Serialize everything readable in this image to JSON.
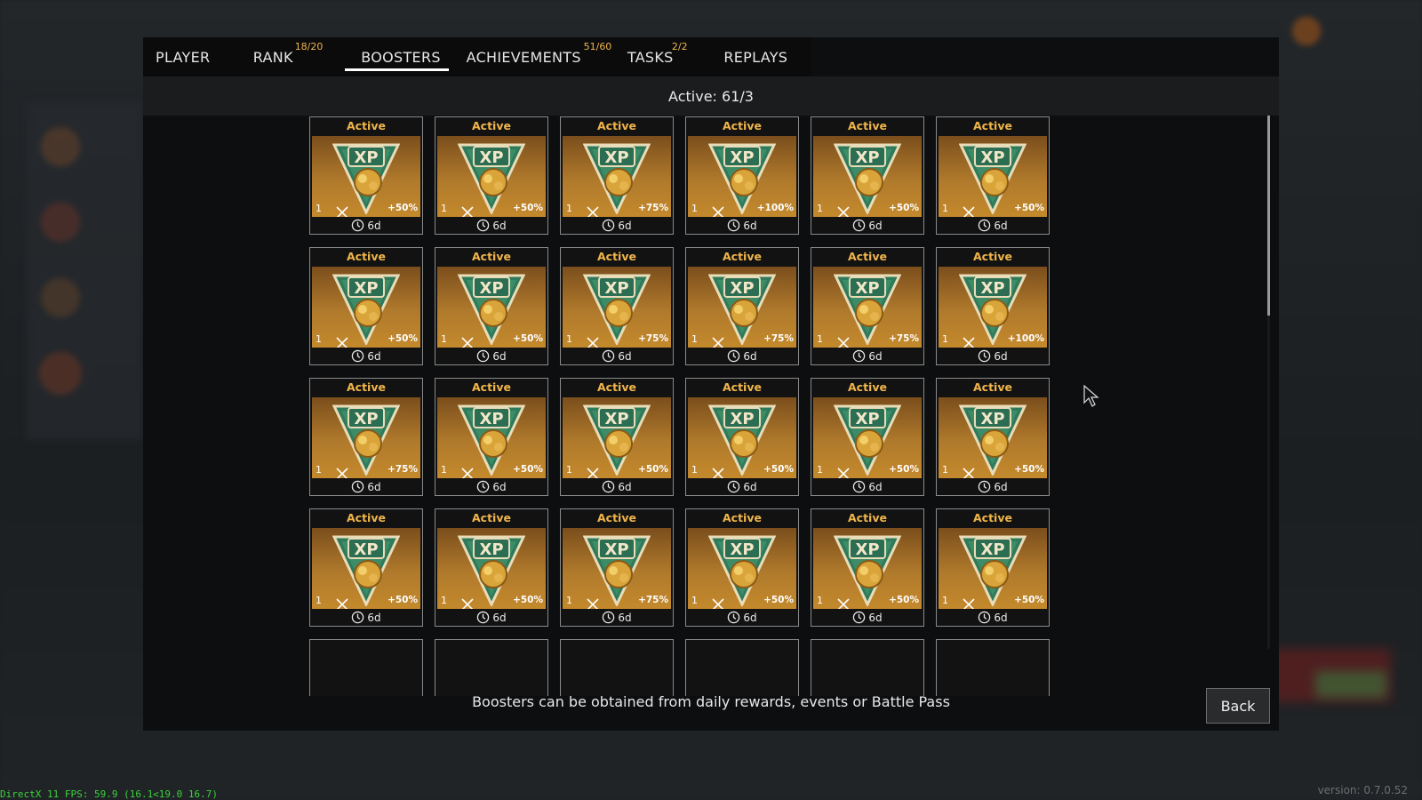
{
  "tabs": [
    {
      "label": "PLAYER",
      "badge": ""
    },
    {
      "label": "RANK",
      "badge": "18/20"
    },
    {
      "label": "BOOSTERS",
      "badge": ""
    },
    {
      "label": "ACHIEVEMENTS",
      "badge": "51/60"
    },
    {
      "label": "TASKS",
      "badge": "2/2"
    },
    {
      "label": "REPLAYS",
      "badge": ""
    }
  ],
  "active_tab": "BOOSTERS",
  "active_summary": "Active: 61/3",
  "boosters": [
    {
      "state": "Active",
      "count": "1",
      "bonus": "+50%",
      "time": "6d"
    },
    {
      "state": "Active",
      "count": "1",
      "bonus": "+50%",
      "time": "6d"
    },
    {
      "state": "Active",
      "count": "1",
      "bonus": "+75%",
      "time": "6d"
    },
    {
      "state": "Active",
      "count": "1",
      "bonus": "+100%",
      "time": "6d"
    },
    {
      "state": "Active",
      "count": "1",
      "bonus": "+50%",
      "time": "6d"
    },
    {
      "state": "Active",
      "count": "1",
      "bonus": "+50%",
      "time": "6d"
    },
    {
      "state": "Active",
      "count": "1",
      "bonus": "+50%",
      "time": "6d"
    },
    {
      "state": "Active",
      "count": "1",
      "bonus": "+50%",
      "time": "6d"
    },
    {
      "state": "Active",
      "count": "1",
      "bonus": "+75%",
      "time": "6d"
    },
    {
      "state": "Active",
      "count": "1",
      "bonus": "+75%",
      "time": "6d"
    },
    {
      "state": "Active",
      "count": "1",
      "bonus": "+75%",
      "time": "6d"
    },
    {
      "state": "Active",
      "count": "1",
      "bonus": "+100%",
      "time": "6d"
    },
    {
      "state": "Active",
      "count": "1",
      "bonus": "+75%",
      "time": "6d"
    },
    {
      "state": "Active",
      "count": "1",
      "bonus": "+50%",
      "time": "6d"
    },
    {
      "state": "Active",
      "count": "1",
      "bonus": "+50%",
      "time": "6d"
    },
    {
      "state": "Active",
      "count": "1",
      "bonus": "+50%",
      "time": "6d"
    },
    {
      "state": "Active",
      "count": "1",
      "bonus": "+50%",
      "time": "6d"
    },
    {
      "state": "Active",
      "count": "1",
      "bonus": "+50%",
      "time": "6d"
    },
    {
      "state": "Active",
      "count": "1",
      "bonus": "+50%",
      "time": "6d"
    },
    {
      "state": "Active",
      "count": "1",
      "bonus": "+50%",
      "time": "6d"
    },
    {
      "state": "Active",
      "count": "1",
      "bonus": "+75%",
      "time": "6d"
    },
    {
      "state": "Active",
      "count": "1",
      "bonus": "+50%",
      "time": "6d"
    },
    {
      "state": "Active",
      "count": "1",
      "bonus": "+50%",
      "time": "6d"
    },
    {
      "state": "Active",
      "count": "1",
      "bonus": "+50%",
      "time": "6d"
    }
  ],
  "booster_icon": "xp-booster-icon",
  "footer_message": "Boosters can be obtained from daily rewards, events or Battle Pass",
  "back_label": "Back",
  "fps_text": "DirectX 11 FPS: 59.9 (16.1<19.0 16.7)",
  "version_text": "version: 0.7.0.52",
  "colors": {
    "accent": "#f0b54a",
    "card_gold": "#c4892c",
    "shield_green": "#2f7a5a"
  }
}
